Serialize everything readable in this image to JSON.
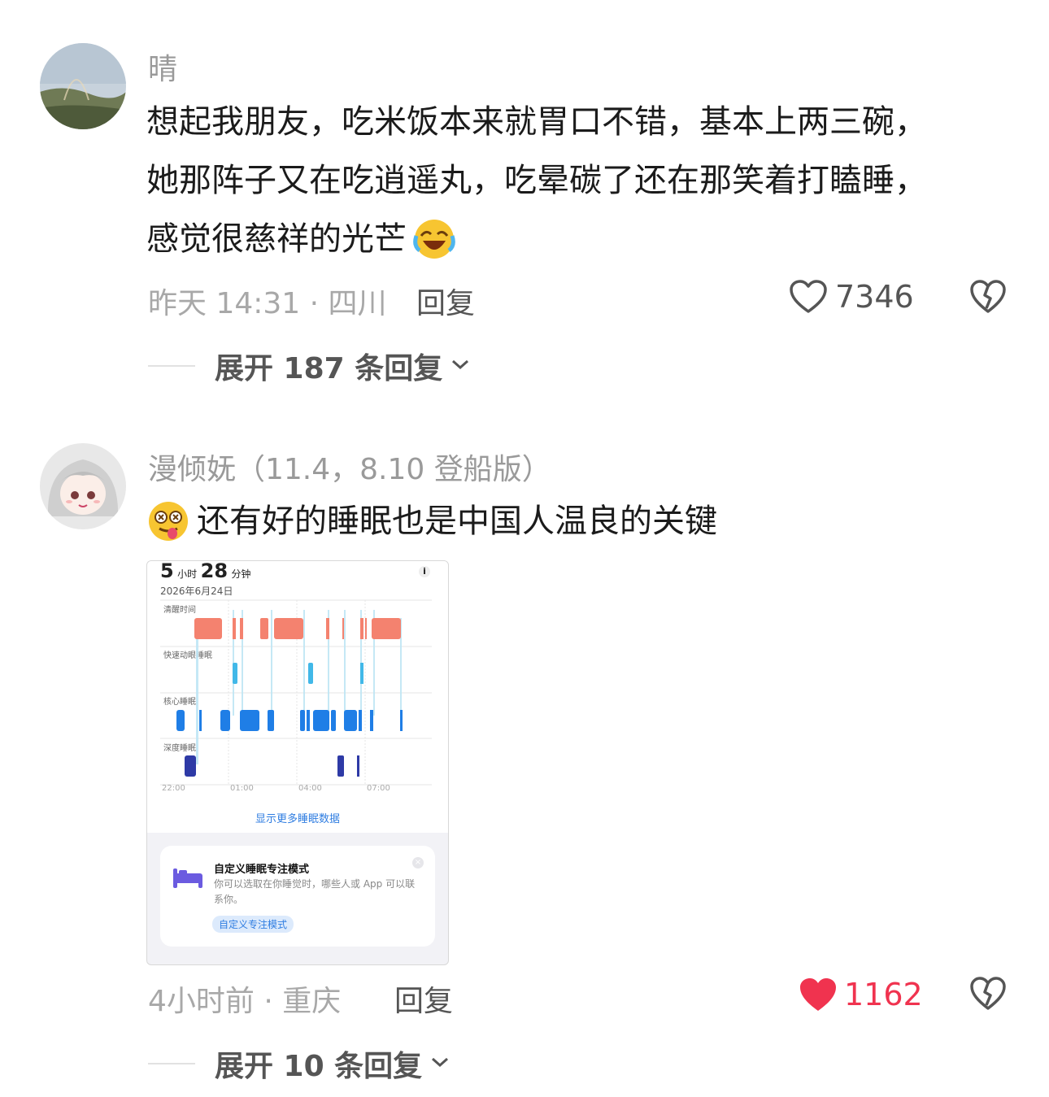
{
  "comments": [
    {
      "username": "晴",
      "text_lines": [
        "想起我朋友，吃米饭本来就胃口不错，基本上两三碗，",
        "她那阵子又在吃逍遥丸，吃晕碳了还在那笑着打瞌睡，",
        "感觉很慈祥的光芒"
      ],
      "emoji": "laughing-crying-emoji",
      "meta": "昨天 14:31 · 四川",
      "reply_label": "回复",
      "like_count": "7346",
      "liked": false,
      "expand_label": "展开 187 条回复"
    },
    {
      "username": "漫倾妩（11.4，8.10 登船版）",
      "text": "还有好的睡眠也是中国人温良的关键",
      "emoji": "dizzy-tongue-emoji",
      "meta": "4小时前 · 重庆",
      "reply_label": "回复",
      "like_count": "1162",
      "liked": true,
      "expand_label": "展开 10 条回复"
    }
  ],
  "sleep_card": {
    "hours": "5",
    "hours_unit": "小时",
    "minutes": "28",
    "minutes_unit": "分钟",
    "date": "2026年6月24日",
    "info": "i",
    "rows": [
      "清醒时间",
      "快速动眼睡眠",
      "核心睡眠",
      "深度睡眠"
    ],
    "ticks": [
      "22:00",
      "01:00",
      "04:00",
      "07:00"
    ],
    "more_link": "显示更多睡眠数据",
    "focus_title": "自定义睡眠专注模式",
    "focus_desc": "你可以选取在你睡觉时，哪些人或 App 可以联系你。",
    "focus_button": "自定义专注模式",
    "close": "×"
  },
  "colors": {
    "like_active": "#f0334f",
    "awake": "#f4826f",
    "rem": "#41b8e8",
    "core": "#1f7ee6",
    "deep": "#2e3aa6",
    "link": "#2f7de1"
  }
}
